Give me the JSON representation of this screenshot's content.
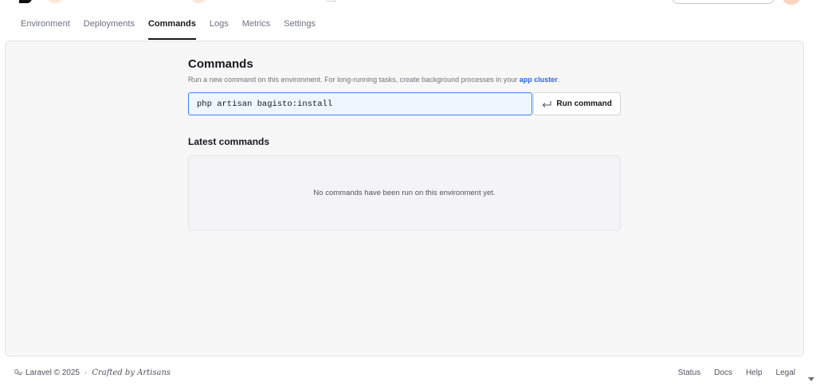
{
  "tabs": [
    {
      "label": "Environment",
      "active": false
    },
    {
      "label": "Deployments",
      "active": false
    },
    {
      "label": "Commands",
      "active": true
    },
    {
      "label": "Logs",
      "active": false
    },
    {
      "label": "Metrics",
      "active": false
    },
    {
      "label": "Settings",
      "active": false
    }
  ],
  "commands": {
    "title": "Commands",
    "description": "Run a new command on this environment. For long-running tasks, create background processes in your",
    "link_text": "app cluster",
    "input_value": "php artisan bagisto:install",
    "run_label": "Run command"
  },
  "latest": {
    "title": "Latest commands",
    "empty_text": "No commands have been run on this environment yet."
  },
  "footer": {
    "brand": "Laravel © 2025",
    "separator": "·",
    "crafted": "Crafted by Artisans",
    "links": [
      "Status",
      "Docs",
      "Help",
      "Legal"
    ]
  },
  "colors": {
    "accent": "#2563eb",
    "input_border": "#3b82f6",
    "panel_bg": "#f7f7f8"
  }
}
